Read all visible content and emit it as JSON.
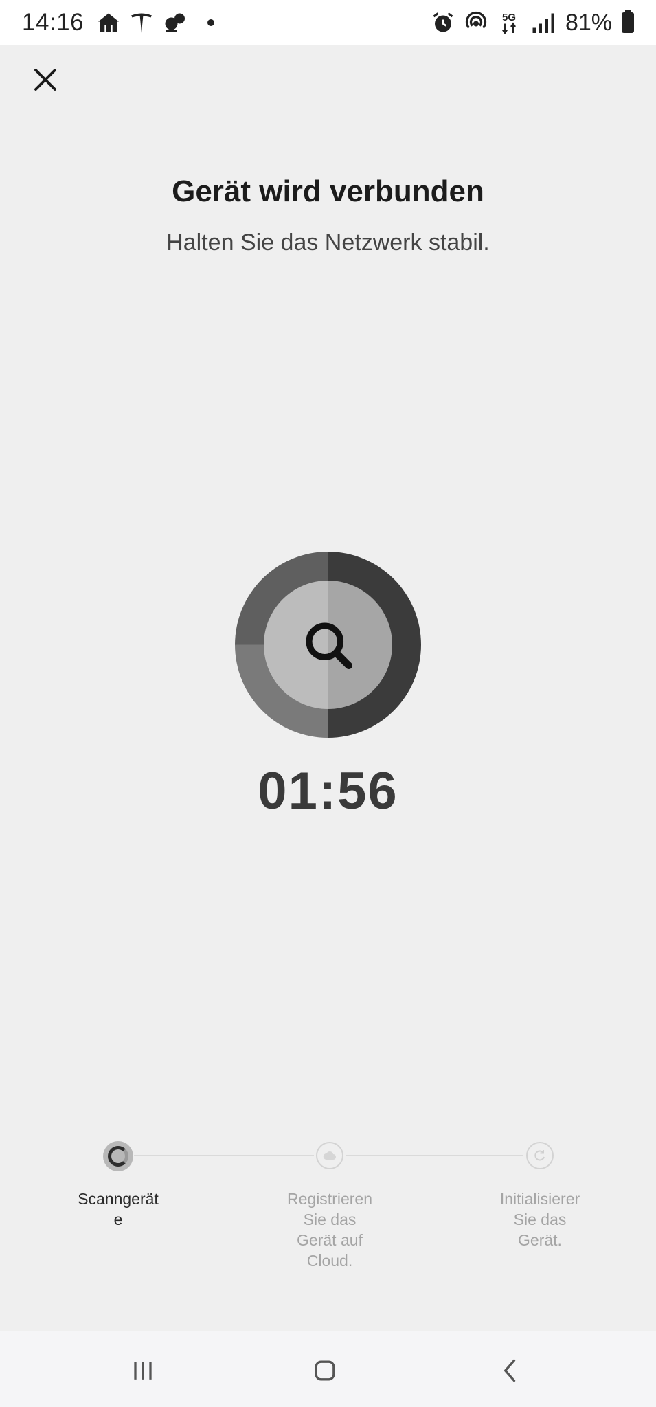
{
  "status_bar": {
    "time": "14:16",
    "battery_percent": "81%",
    "network": "5G",
    "left_icons": [
      "restaurant-house-icon",
      "tesla-icon",
      "squirrel-icon"
    ],
    "right_icons": [
      "alarm-icon",
      "hotspot-icon",
      "5g-data-icon",
      "signal-icon",
      "battery-icon"
    ]
  },
  "header": {
    "title": "Gerät wird verbunden",
    "subtitle": "Halten Sie das Netzwerk stabil."
  },
  "scan": {
    "icon": "search-icon",
    "timer": "01:56"
  },
  "steps": [
    {
      "label": "Scanngerät\ne",
      "state": "active",
      "icon": "spinner-icon"
    },
    {
      "label": "Registrieren\nSie das\nGerät auf\nCloud.",
      "state": "pending",
      "icon": "cloud-icon"
    },
    {
      "label": "Initialisierer\nSie das\nGerät.",
      "state": "pending",
      "icon": "refresh-icon"
    }
  ],
  "colors": {
    "background": "#efefef",
    "status_bar": "#ffffff",
    "nav_bar": "#f5f5f7",
    "active_text": "#2a2a2a",
    "inactive_text": "#a4a4a4"
  },
  "nav": {
    "recent_icon": "recent-apps-icon",
    "home_icon": "home-icon",
    "back_icon": "back-icon"
  }
}
